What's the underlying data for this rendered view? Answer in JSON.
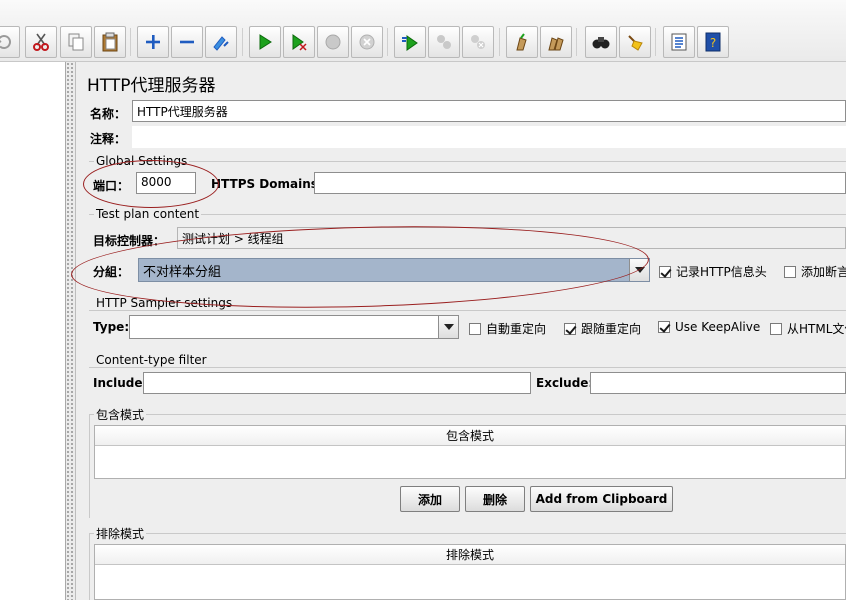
{
  "panel": {
    "title": "HTTP代理服务器",
    "name_label": "名称：",
    "name_value": "HTTP代理服务器",
    "comment_label": "注释："
  },
  "global_settings": {
    "title": "Global Settings",
    "port_label": "端口：",
    "port_value": "8000",
    "https_domains_label": "HTTPS Domains :"
  },
  "test_plan": {
    "title": "Test plan content",
    "target_label": "目标控制器：",
    "target_value": "测试计划 > 线程组",
    "grouping_label": "分組：",
    "grouping_value": "不对样本分組",
    "record_http_headers_label": "记录HTTP信息头",
    "record_http_headers_checked": true,
    "add_assertions_label": "添加断言",
    "add_assertions_checked": false
  },
  "sampler": {
    "title": "HTTP Sampler settings",
    "type_label": "Type:",
    "type_value": "",
    "auto_redirect_label": "自動重定向",
    "auto_redirect_checked": false,
    "follow_redirect_label": "跟随重定向",
    "follow_redirect_checked": true,
    "keepalive_label": "Use KeepAlive",
    "keepalive_checked": true,
    "from_html_label": "从HTML文件",
    "from_html_checked": false
  },
  "content_type": {
    "title": "Content-type filter",
    "include_label": "Include:",
    "exclude_label": "Exclude:"
  },
  "include_patterns": {
    "title": "包含模式",
    "column": "包含模式",
    "add_button": "添加",
    "delete_button": "删除",
    "clipboard_button": "Add from Clipboard"
  },
  "exclude_patterns": {
    "title": "排除模式",
    "column": "排除模式"
  },
  "toolbar_icons": [
    "revert-icon",
    "cut-icon",
    "copy-icon",
    "paste-icon",
    "expand-icon",
    "collapse-icon",
    "toggle-icon",
    "start-icon",
    "start-no-pause-icon",
    "stop-icon",
    "shutdown-icon",
    "remote-start-icon",
    "remote-stop-icon",
    "remote-shutdown-icon",
    "clear-icon",
    "clear-all-icon",
    "search-icon",
    "reset-search-icon",
    "function-helper-icon",
    "help-icon"
  ],
  "colors": {
    "annotation": "#9a1f1f",
    "selected_combo": "#a4b5cb"
  }
}
